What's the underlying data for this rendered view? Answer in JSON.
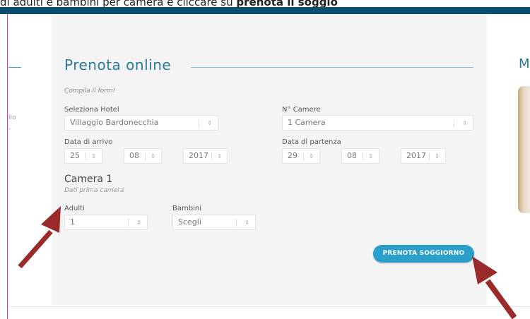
{
  "caption": {
    "prefix": "di adulti e bambini per camera e cliccare su ",
    "bold": "prenota il soggio"
  },
  "left_column": {
    "line1": "lio",
    "line2": "."
  },
  "form": {
    "title": "Prenota online",
    "subtitle": "Compila il form!",
    "hotel": {
      "label": "Seleziona Hotel",
      "value": "Villaggio Bardonecchia"
    },
    "rooms": {
      "label": "N° Camere",
      "value": "1 Camera"
    },
    "arrival": {
      "label": "Data di arrivo",
      "day": "25",
      "month": "08",
      "year": "2017"
    },
    "departure": {
      "label": "Data di partenza",
      "day": "29",
      "month": "08",
      "year": "2017"
    },
    "room1": {
      "title": "Camera 1",
      "subtitle": "Dati prima camera",
      "adults": {
        "label": "Adulti",
        "value": "1"
      },
      "children": {
        "label": "Bambini",
        "value": "Scegli"
      }
    },
    "submit_label": "PRENOTA SOGGIORNO"
  },
  "right_column": {
    "letter": "M"
  },
  "icons": {
    "select_arrow": "up-down-arrows-icon",
    "pointer": "red-arrow-icon"
  },
  "colors": {
    "accent": "#2a9fc9",
    "title": "#2b7a9b",
    "header_bar": "#0d4e6e",
    "annotation_arrow": "#9b2a2a"
  }
}
